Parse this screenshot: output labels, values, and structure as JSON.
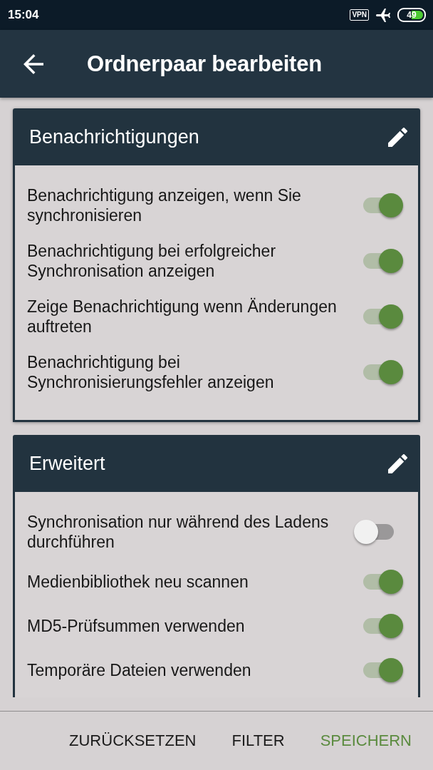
{
  "status_bar": {
    "time": "15:04",
    "vpn": "VPN",
    "battery": "49"
  },
  "app_bar": {
    "title": "Ordnerpaar bearbeiten"
  },
  "sections": [
    {
      "title": "Benachrichtigungen",
      "settings": [
        {
          "label": "Benachrichtigung anzeigen, wenn Sie synchronisieren",
          "on": true
        },
        {
          "label": "Benachrichtigung bei erfolgreicher Synchronisation anzeigen",
          "on": true
        },
        {
          "label": "Zeige Benachrichtigung wenn Änderungen auftreten",
          "on": true
        },
        {
          "label": "Benachrichtigung bei Synchronisierungsfehler anzeigen",
          "on": true
        }
      ]
    },
    {
      "title": "Erweitert",
      "settings": [
        {
          "label": "Synchronisation nur während des Ladens durchführen",
          "on": false
        },
        {
          "label": "Medienbibliothek neu scannen",
          "on": true
        },
        {
          "label": "MD5-Prüfsummen verwenden",
          "on": true
        },
        {
          "label": "Temporäre Dateien verwenden",
          "on": true
        }
      ]
    }
  ],
  "actions": [
    {
      "label": "ZURÜCKSETZEN",
      "primary": false
    },
    {
      "label": "FILTER",
      "primary": false
    },
    {
      "label": "SPEICHERN",
      "primary": true
    }
  ]
}
